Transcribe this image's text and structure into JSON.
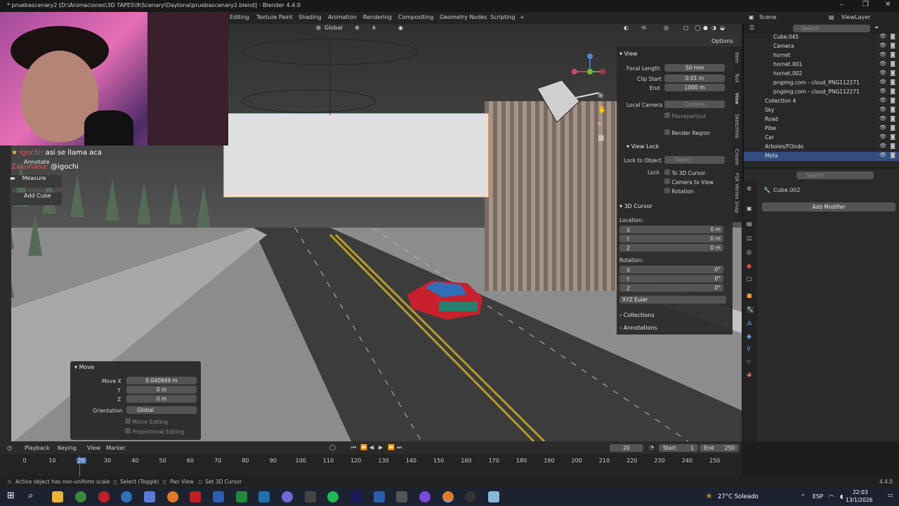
{
  "window": {
    "title": "* pruebascenary2 [D:\\Animaciones\\3D TAPES\\9\\Scenary\\Daytona\\pruebascenary2.blend] - Blender 4.4.0"
  },
  "workspaces": [
    "Editing",
    "Texture Paint",
    "Shading",
    "Animation",
    "Rendering",
    "Compositing",
    "Geometry Nodes",
    "Scripting",
    "+"
  ],
  "scene": {
    "scene_name": "Scene",
    "view_layer": "ViewLayer"
  },
  "viewport_header": {
    "orientation": "Global",
    "options": "Options"
  },
  "chat": {
    "line1_user": "igochi:",
    "line1_text": "asi se llama aca",
    "line2_user": "Zakunaaa:",
    "line2_text": "@igochi"
  },
  "tools": {
    "annotate": "Annotate",
    "measure": "Measure",
    "add_cube": "Add Cube"
  },
  "npanel": {
    "view_section": "View",
    "focal_length_label": "Focal Length",
    "focal_length": "50 mm",
    "clip_start_label": "Clip Start",
    "clip_start": "0.01 m",
    "end_label": "End",
    "end": "1000 m",
    "local_camera_label": "Local Camera",
    "local_camera": "Camera",
    "passepartout": "Passepartout",
    "render_region": "Render Region",
    "view_lock_section": "View Lock",
    "lock_to_object_label": "Lock to Object",
    "lock_to_object_placeholder": "Object",
    "lock_label": "Lock",
    "to_3d_cursor": "To 3D Cursor",
    "camera_to_view": "Camera to View",
    "rotation_chk": "Rotation",
    "cursor_section": "3D Cursor",
    "location_label": "Location:",
    "x": "X",
    "y": "Y",
    "z": "Z",
    "loc_x": "0 m",
    "loc_y": "0 m",
    "loc_z": "0 m",
    "rotation_label": "Rotation:",
    "rot_x": "0°",
    "rot_y": "0°",
    "rot_z": "0°",
    "rotation_mode": "XYZ Euler",
    "collections_section": "Collections",
    "annotations_section": "Annotations"
  },
  "ntabs": [
    "Item",
    "Tool",
    "View",
    "Sketchfab",
    "Create",
    "FSK Vertex Snap"
  ],
  "move_panel": {
    "title": "Move",
    "move_x_label": "Move X",
    "move_x": "0.040849 m",
    "y_label": "Y",
    "y": "0 m",
    "z_label": "Z",
    "z": "0 m",
    "orientation_label": "Orientation",
    "orientation": "Global",
    "mirror": "Mirror Editing",
    "proportional": "Proportional Editing"
  },
  "outliner": {
    "search_placeholder": "Search",
    "items": [
      "Cube.045",
      "Camera",
      "hornet",
      "hornet.001",
      "hornet.002",
      "pngimg.com - cloud_PNG112271",
      "pngimg.com - cloud_PNG112271",
      "Collection 4",
      "Sky",
      "Road",
      "Pibe",
      "Car",
      "Arboles/FOndo",
      "Meta"
    ]
  },
  "properties": {
    "search_placeholder": "Search",
    "object_name": "Cube.002",
    "add_modifier": "Add Modifier"
  },
  "timeline": {
    "playback": "Playback",
    "keying": "Keying",
    "view": "View",
    "marker": "Marker",
    "current_frame": "20",
    "start_label": "Start",
    "start": "1",
    "end_label": "End",
    "end": "250",
    "ticks": [
      "0",
      "10",
      "20",
      "30",
      "40",
      "50",
      "60",
      "70",
      "80",
      "90",
      "100",
      "110",
      "120",
      "130",
      "140",
      "150",
      "160",
      "170",
      "180",
      "190",
      "200",
      "210",
      "220",
      "230",
      "240",
      "250"
    ]
  },
  "status": {
    "message": "Active object has non-uniform scale",
    "select": "Select (Toggle)",
    "pan": "Pan View",
    "set_cursor": "Set 3D Cursor",
    "version": "4.4.0"
  },
  "taskbar": {
    "weather": "27°C Soleado",
    "lang": "ESP",
    "time": "22:03",
    "date": "13/1/2026"
  },
  "colors": {
    "accent": "#4772b3",
    "selection": "#e69a3c",
    "frame_marker": "#4772b3"
  }
}
